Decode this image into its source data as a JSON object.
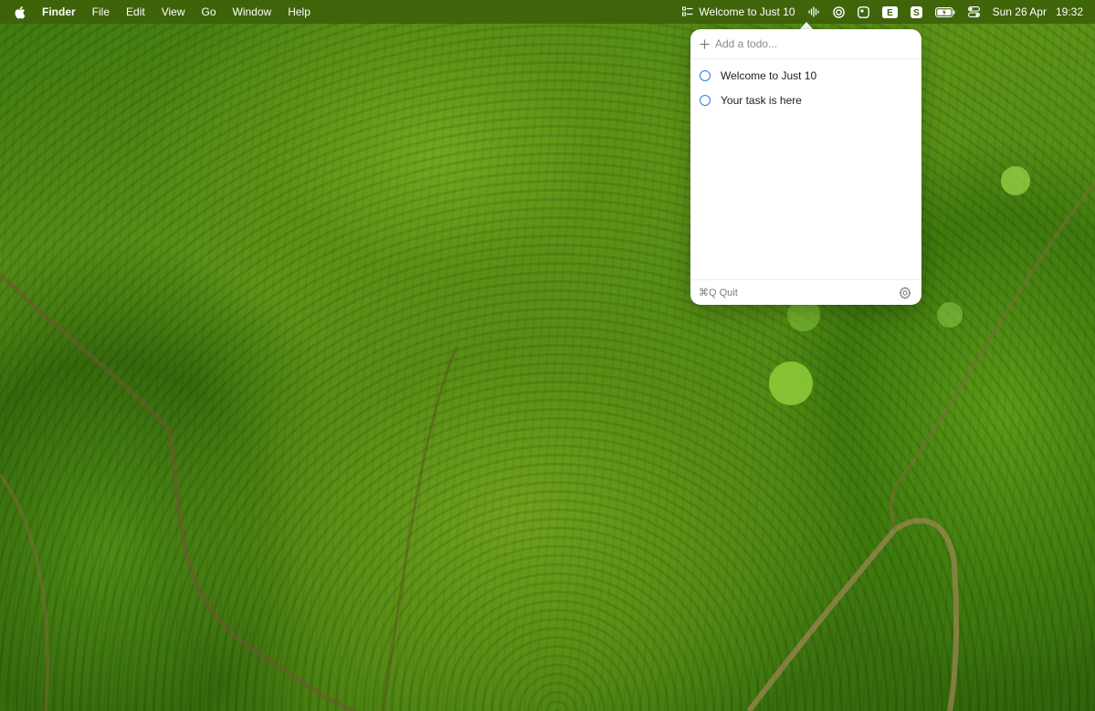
{
  "menubar": {
    "app_name": "Finder",
    "menus": [
      "File",
      "Edit",
      "View",
      "Go",
      "Window",
      "Help"
    ],
    "status": {
      "app_title": "Welcome to Just 10",
      "date": "Sun 26 Apr",
      "time": "19:32",
      "icons": [
        "checklist-icon",
        "waveform-icon",
        "circle-logo-icon",
        "square-app-icon",
        "e-badge-icon",
        "s-badge-icon",
        "battery-icon",
        "control-center-icon"
      ],
      "e_badge_letter": "E",
      "s_badge_letter": "S"
    }
  },
  "popover": {
    "add_placeholder": "Add a todo...",
    "todos": [
      {
        "text": "Welcome to Just 10",
        "done": false
      },
      {
        "text": "Your task is here",
        "done": false
      }
    ],
    "footer": {
      "quit_label": "⌘Q Quit"
    }
  },
  "colors": {
    "accent_blue": "#2f7de1",
    "menubar_bg": "#3e620a",
    "popover_bg": "#ffffff"
  }
}
